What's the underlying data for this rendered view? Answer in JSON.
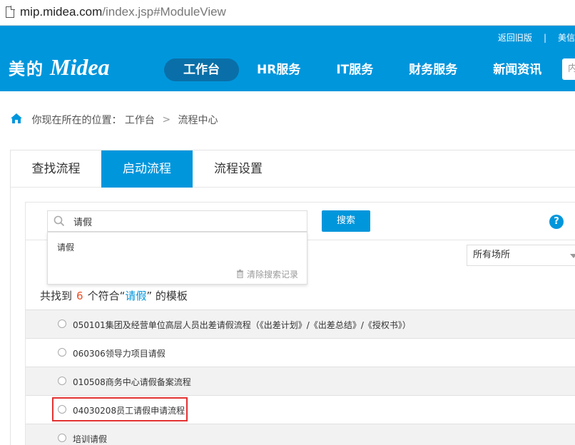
{
  "browser": {
    "url_host": "mip.midea.com",
    "url_path": "/index.jsp#ModuleView"
  },
  "header": {
    "logo_cn": "美的",
    "logo_en": "Midea",
    "links": {
      "old_version": "返回旧版",
      "separator": "|",
      "meixin": "美信"
    },
    "nav": [
      "工作台",
      "HR服务",
      "IT服务",
      "财务服务",
      "新闻资讯"
    ],
    "search_hint": "内"
  },
  "breadcrumb": {
    "prefix": "你现在所在的位置：",
    "items": [
      "工作台",
      "流程中心"
    ],
    "separator": ">"
  },
  "tabs": [
    "查找流程",
    "启动流程",
    "流程设置"
  ],
  "search": {
    "value": "请假",
    "button": "搜索",
    "suggestion": "请假",
    "clear_history": "清除搜索记录"
  },
  "filter": {
    "location": "所有场所"
  },
  "result": {
    "prefix": "共找到",
    "count": "6",
    "middle": "个符合“",
    "keyword": "请假",
    "suffix": "” 的模板"
  },
  "templates": [
    "050101集团及经营单位高层人员出差请假流程（《出差计划》/《出差总结》/《授权书》）",
    "060306领导力项目请假",
    "010508商务中心请假备案流程",
    "04030208员工请假申请流程",
    "培训请假"
  ],
  "colors": {
    "brand": "#0096dc",
    "nav_active": "#0a6fa8",
    "count": "#f04e23",
    "highlight": "#e33232"
  }
}
